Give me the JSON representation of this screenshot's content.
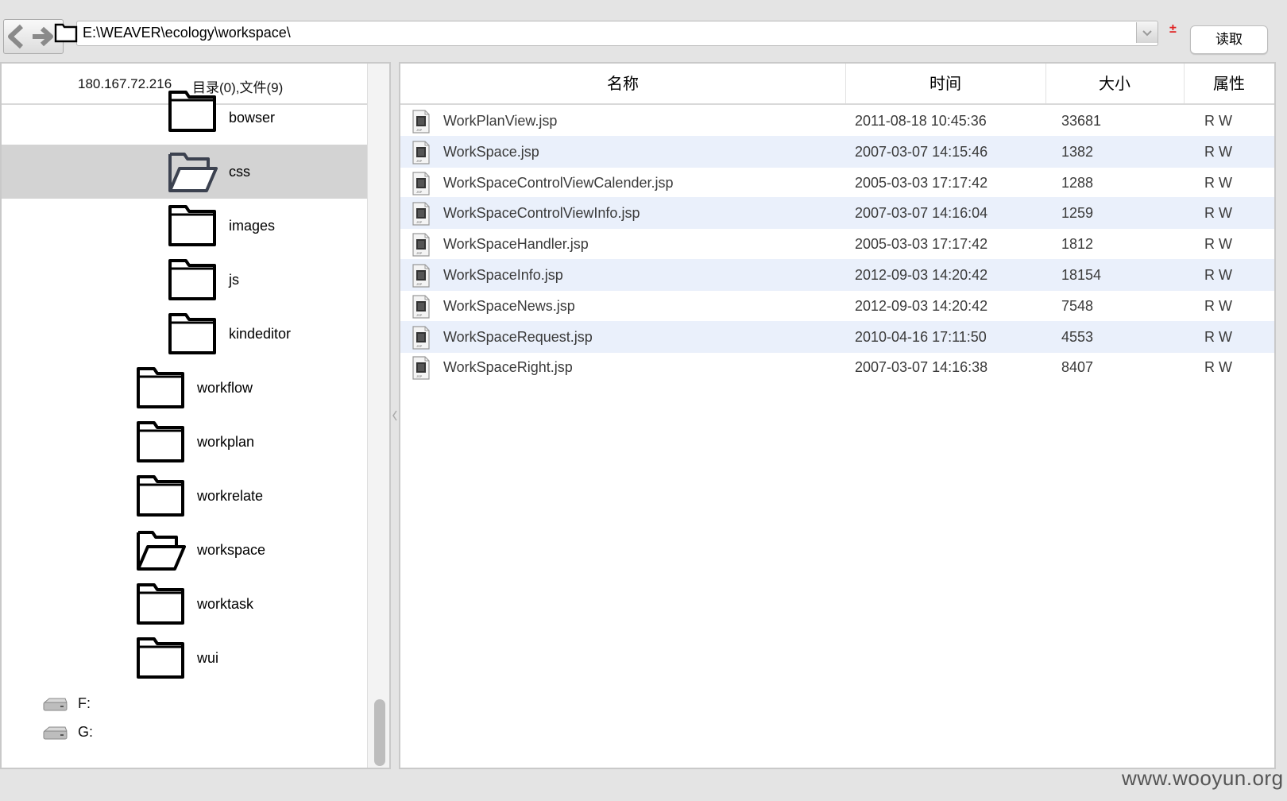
{
  "toolbar": {
    "back_icon": "arrow-left-icon",
    "forward_icon": "arrow-right-icon",
    "path": "E:\\WEAVER\\ecology\\workspace\\",
    "plus_mark": "±",
    "read_label": "读取"
  },
  "left": {
    "host": "180.167.72.216",
    "summary": "目录(0),文件(9)",
    "tree": [
      {
        "label": "bowser",
        "open": false,
        "selected": false
      },
      {
        "label": "css",
        "open": true,
        "selected": true
      },
      {
        "label": "images",
        "open": false,
        "selected": false
      },
      {
        "label": "js",
        "open": false,
        "selected": false
      },
      {
        "label": "kindeditor",
        "open": false,
        "selected": false
      },
      {
        "label": "workflow",
        "open": false,
        "selected": false
      },
      {
        "label": "workplan",
        "open": false,
        "selected": false
      },
      {
        "label": "workrelate",
        "open": false,
        "selected": false
      },
      {
        "label": "workspace",
        "open": true,
        "selected": false
      },
      {
        "label": "worktask",
        "open": false,
        "selected": false
      },
      {
        "label": "wui",
        "open": false,
        "selected": false
      }
    ],
    "drives": [
      {
        "label": "F:"
      },
      {
        "label": "G:"
      }
    ]
  },
  "table": {
    "columns": [
      "名称",
      "时间",
      "大小",
      "属性"
    ],
    "rows": [
      {
        "name": "WorkPlanView.jsp",
        "time": "2011-08-18 10:45:36",
        "size": "33681",
        "attr": "R W"
      },
      {
        "name": "WorkSpace.jsp",
        "time": "2007-03-07 14:15:46",
        "size": "1382",
        "attr": "R W"
      },
      {
        "name": "WorkSpaceControlViewCalender.jsp",
        "time": "2005-03-03 17:17:42",
        "size": "1288",
        "attr": "R W"
      },
      {
        "name": "WorkSpaceControlViewInfo.jsp",
        "time": "2007-03-07 14:16:04",
        "size": "1259",
        "attr": "R W"
      },
      {
        "name": "WorkSpaceHandler.jsp",
        "time": "2005-03-03 17:17:42",
        "size": "1812",
        "attr": "R W"
      },
      {
        "name": "WorkSpaceInfo.jsp",
        "time": "2012-09-03 14:20:42",
        "size": "18154",
        "attr": "R W"
      },
      {
        "name": "WorkSpaceNews.jsp",
        "time": "2012-09-03 14:20:42",
        "size": "7548",
        "attr": "R W"
      },
      {
        "name": "WorkSpaceRequest.jsp",
        "time": "2010-04-16 17:11:50",
        "size": "4553",
        "attr": "R W"
      },
      {
        "name": "WorkSpaceRight.jsp",
        "time": "2007-03-07 14:16:38",
        "size": "8407",
        "attr": "R W"
      }
    ]
  },
  "watermark": "www.wooyun.org",
  "colors": {
    "selected_row": "#d3d3d3",
    "alt_row": "#eaf0fb",
    "plus": "#e02020"
  }
}
